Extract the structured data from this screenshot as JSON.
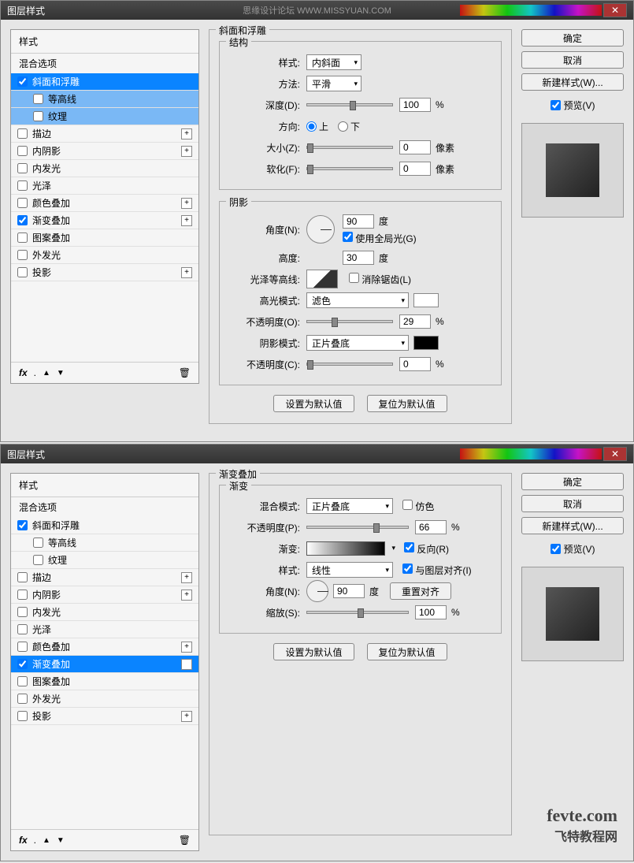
{
  "dialog1": {
    "title": "图层样式",
    "watermark": "思缘设计论坛  WWW.MISSYUAN.COM",
    "left": {
      "header": "样式",
      "blending": "混合选项",
      "items": [
        {
          "label": "斜面和浮雕",
          "checked": true,
          "selected": true,
          "plus": false,
          "indent": false
        },
        {
          "label": "等高线",
          "checked": false,
          "selected": false,
          "sub": true,
          "plus": false,
          "indent": true
        },
        {
          "label": "纹理",
          "checked": false,
          "selected": false,
          "sub": true,
          "plus": false,
          "indent": true
        },
        {
          "label": "描边",
          "checked": false,
          "plus": true,
          "indent": false
        },
        {
          "label": "内阴影",
          "checked": false,
          "plus": true,
          "indent": false
        },
        {
          "label": "内发光",
          "checked": false,
          "plus": false,
          "indent": false
        },
        {
          "label": "光泽",
          "checked": false,
          "plus": false,
          "indent": false
        },
        {
          "label": "颜色叠加",
          "checked": false,
          "plus": true,
          "indent": false
        },
        {
          "label": "渐变叠加",
          "checked": true,
          "plus": true,
          "indent": false
        },
        {
          "label": "图案叠加",
          "checked": false,
          "plus": false,
          "indent": false
        },
        {
          "label": "外发光",
          "checked": false,
          "plus": false,
          "indent": false
        },
        {
          "label": "投影",
          "checked": false,
          "plus": true,
          "indent": false
        }
      ],
      "fx": "fx"
    },
    "center": {
      "main_title": "斜面和浮雕",
      "structure": {
        "title": "结构",
        "style_label": "样式:",
        "style_value": "内斜面",
        "method_label": "方法:",
        "method_value": "平滑",
        "depth_label": "深度(D):",
        "depth_value": "100",
        "depth_unit": "%",
        "direction_label": "方向:",
        "up": "上",
        "down": "下",
        "size_label": "大小(Z):",
        "size_value": "0",
        "size_unit": "像素",
        "soften_label": "软化(F):",
        "soften_value": "0",
        "soften_unit": "像素"
      },
      "shading": {
        "title": "阴影",
        "angle_label": "角度(N):",
        "angle_value": "90",
        "angle_unit": "度",
        "global_light": "使用全局光(G)",
        "altitude_label": "高度:",
        "altitude_value": "30",
        "altitude_unit": "度",
        "gloss_label": "光泽等高线:",
        "antialias": "消除锯齿(L)",
        "highlight_label": "高光模式:",
        "highlight_value": "滤色",
        "opacity1_label": "不透明度(O):",
        "opacity1_value": "29",
        "opacity1_unit": "%",
        "shadow_label": "阴影模式:",
        "shadow_value": "正片叠底",
        "opacity2_label": "不透明度(C):",
        "opacity2_value": "0",
        "opacity2_unit": "%"
      },
      "btn_default": "设置为默认值",
      "btn_reset": "复位为默认值"
    },
    "right": {
      "ok": "确定",
      "cancel": "取消",
      "new_style": "新建样式(W)...",
      "preview": "预览(V)"
    }
  },
  "dialog2": {
    "title": "图层样式",
    "left": {
      "header": "样式",
      "blending": "混合选项",
      "items": [
        {
          "label": "斜面和浮雕",
          "checked": true,
          "plus": false,
          "indent": false
        },
        {
          "label": "等高线",
          "checked": false,
          "plus": false,
          "indent": true
        },
        {
          "label": "纹理",
          "checked": false,
          "plus": false,
          "indent": true
        },
        {
          "label": "描边",
          "checked": false,
          "plus": true,
          "indent": false
        },
        {
          "label": "内阴影",
          "checked": false,
          "plus": true,
          "indent": false
        },
        {
          "label": "内发光",
          "checked": false,
          "plus": false,
          "indent": false
        },
        {
          "label": "光泽",
          "checked": false,
          "plus": false,
          "indent": false
        },
        {
          "label": "颜色叠加",
          "checked": false,
          "plus": true,
          "indent": false
        },
        {
          "label": "渐变叠加",
          "checked": true,
          "selected": true,
          "plus": true,
          "indent": false
        },
        {
          "label": "图案叠加",
          "checked": false,
          "plus": false,
          "indent": false
        },
        {
          "label": "外发光",
          "checked": false,
          "plus": false,
          "indent": false
        },
        {
          "label": "投影",
          "checked": false,
          "plus": true,
          "indent": false
        }
      ],
      "fx": "fx"
    },
    "center": {
      "main_title": "渐变叠加",
      "gradient": {
        "title": "渐变",
        "blend_label": "混合模式:",
        "blend_value": "正片叠底",
        "dither": "仿色",
        "opacity_label": "不透明度(P):",
        "opacity_value": "66",
        "opacity_unit": "%",
        "grad_label": "渐变:",
        "reverse": "反向(R)",
        "style_label": "样式:",
        "style_value": "线性",
        "align": "与图层对齐(I)",
        "angle_label": "角度(N):",
        "angle_value": "90",
        "angle_unit": "度",
        "reset_align": "重置对齐",
        "scale_label": "缩放(S):",
        "scale_value": "100",
        "scale_unit": "%"
      },
      "btn_default": "设置为默认值",
      "btn_reset": "复位为默认值"
    },
    "right": {
      "ok": "确定",
      "cancel": "取消",
      "new_style": "新建样式(W)...",
      "preview": "预览(V)"
    },
    "watermark": {
      "line1": "fevte.com",
      "line2": "飞特教程网"
    }
  }
}
